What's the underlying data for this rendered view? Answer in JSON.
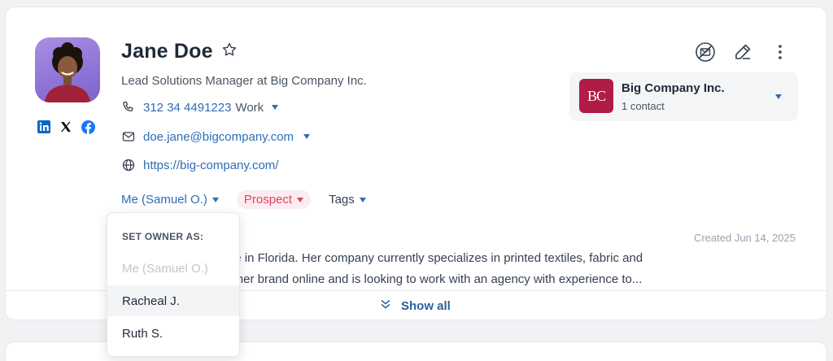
{
  "contact": {
    "name": "Jane Doe",
    "job_title": "Lead Solutions Manager at Big Company Inc.",
    "phone": "312 34 4491223",
    "phone_type": "Work",
    "email": "doe.jane@bigcompany.com",
    "website": "https://big-company.com/",
    "owner": "Me (Samuel O.)",
    "status": "Prospect",
    "tags_label": "Tags",
    "created": "Created Jun 14, 2025",
    "description_line1": "ual Digital Conference in Florida. Her company currently specializes in printed textiles, fabric and",
    "description_line2": "ently started building her brand online and is looking to work with an agency with experience to..."
  },
  "company": {
    "logo_text": "BC",
    "name": "Big Company Inc.",
    "count": "1 contact"
  },
  "show_all_label": "Show all",
  "owner_dropdown": {
    "header": "SET OWNER AS:",
    "options": [
      "Me (Samuel O.)",
      "Racheal J.",
      "Ruth S."
    ]
  },
  "colors": {
    "link": "#2e6db3",
    "prospect": "#d9485f",
    "company_logo": "#b01c46"
  }
}
